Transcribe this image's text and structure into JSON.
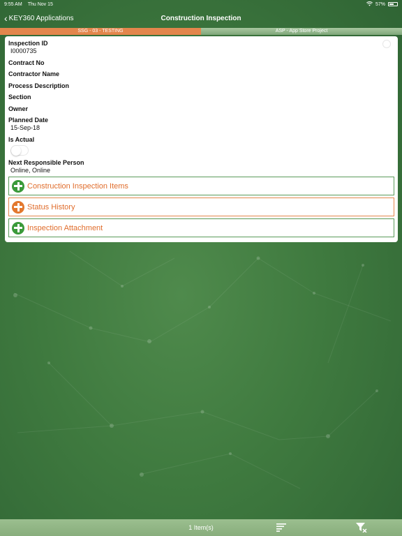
{
  "status_bar": {
    "time": "9:55 AM",
    "date": "Thu Nov 15",
    "battery": "57%",
    "battery_level": 0.57
  },
  "nav": {
    "back_label": "KEY360 Applications",
    "title": "Construction Inspection"
  },
  "project_strip": {
    "left": "SSG - 03 - TESTING",
    "right": "ASP - App Store Project"
  },
  "fields": {
    "inspection_id_label": "Inspection ID",
    "inspection_id_value": "I0000735",
    "contract_no_label": "Contract No",
    "contractor_name_label": "Contractor Name",
    "process_description_label": "Process Description",
    "section_label": "Section",
    "owner_label": "Owner",
    "planned_date_label": "Planned Date",
    "planned_date_value": "15-Sep-18",
    "is_actual_label": "Is Actual",
    "is_actual_value": false,
    "next_person_label": "Next Responsible Person",
    "next_person_value": "Online, Online"
  },
  "sections": [
    {
      "label": "Construction Inspection Items",
      "color": "#3a9a3a"
    },
    {
      "label": "Status History",
      "color": "#e3782e"
    },
    {
      "label": "Inspection Attachment",
      "color": "#3a9a3a"
    }
  ],
  "bottom_bar": {
    "count": "1 Item(s)"
  },
  "colors": {
    "accent_orange": "#e3864c",
    "accent_green": "#3a9a3a",
    "link_text": "#e06d2c"
  },
  "icons": {
    "back": "chevron-left-icon",
    "wifi": "wifi-icon",
    "battery": "battery-icon",
    "add": "add-circle-icon",
    "sort": "sort-icon",
    "filter": "filter-icon"
  }
}
